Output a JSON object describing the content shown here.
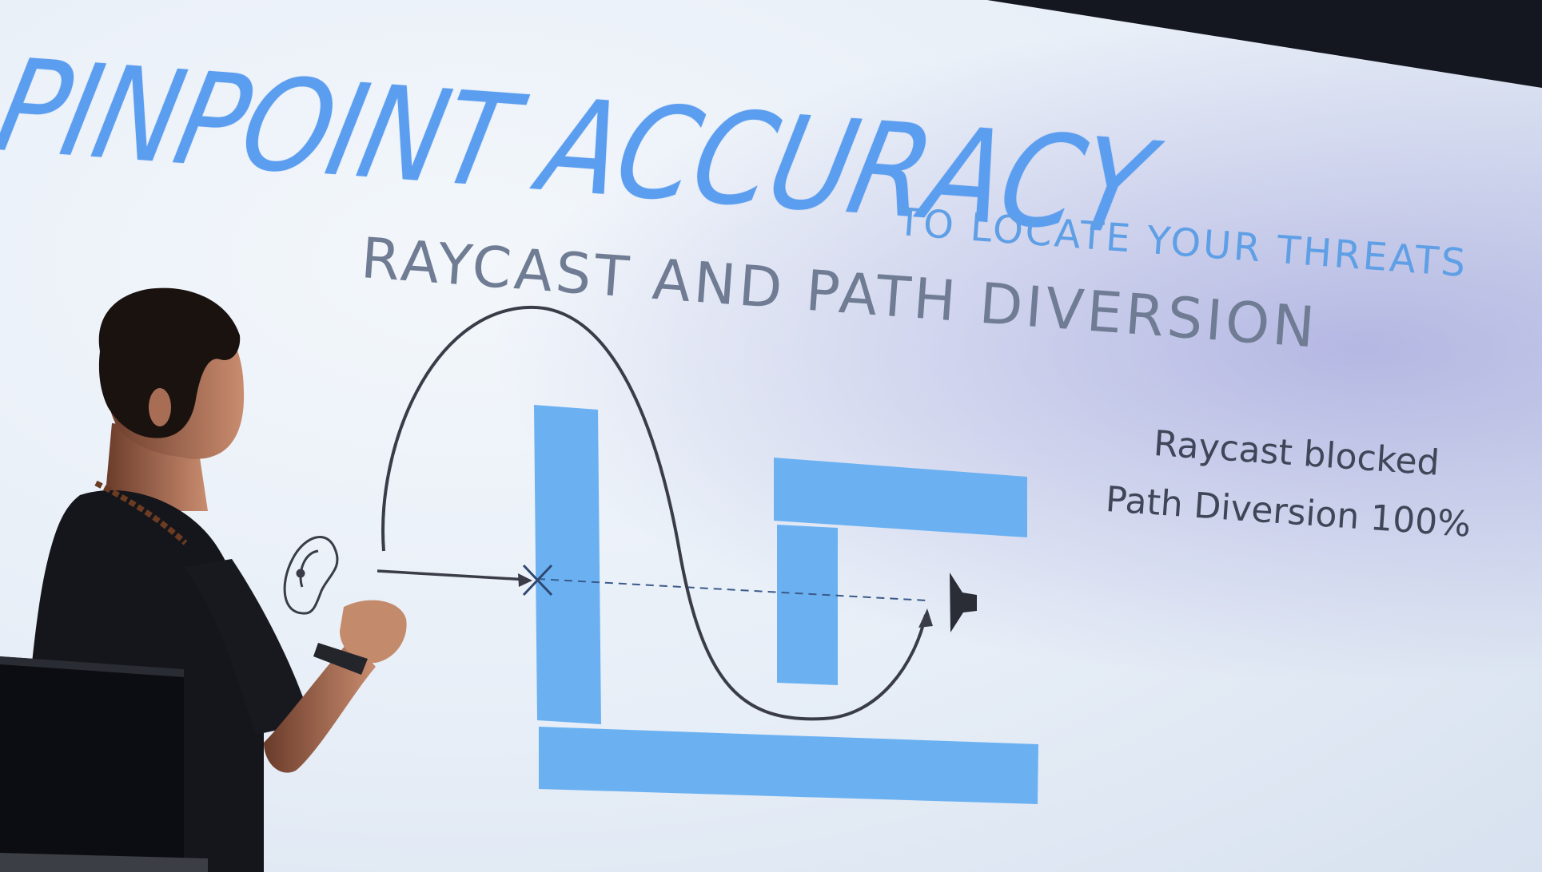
{
  "slide": {
    "title": "PINPOINT ACCURACY",
    "subtitle": "TO LOCATE YOUR THREATS",
    "heading": "RAYCAST AND PATH DIVERSION",
    "notes": [
      "Raycast blocked",
      "Path Diversion 100%"
    ]
  },
  "icons": [
    "ear-icon",
    "speaker-icon",
    "blocked-x-icon"
  ],
  "colors": {
    "title": "#5b9ef0",
    "heading": "#6f7c93",
    "wall": "#6bb1f2",
    "path": "#3a3d48",
    "background": "#e9f0f8"
  }
}
